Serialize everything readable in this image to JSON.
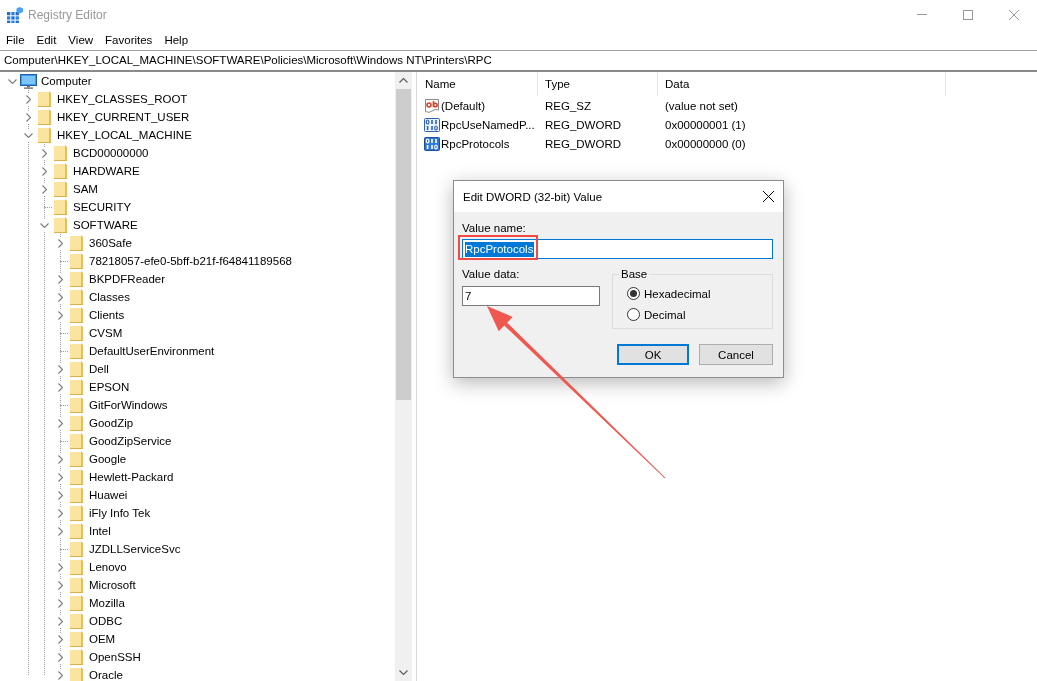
{
  "window": {
    "title": "Registry Editor",
    "active": false
  },
  "menu": [
    "File",
    "Edit",
    "View",
    "Favorites",
    "Help"
  ],
  "address": "Computer\\HKEY_LOCAL_MACHINE\\SOFTWARE\\Policies\\Microsoft\\Windows NT\\Printers\\RPC",
  "tree": [
    {
      "label": "Computer",
      "kind": "computer",
      "has_subkeys": true,
      "expanded": true,
      "children": [
        {
          "label": "HKEY_CLASSES_ROOT",
          "kind": "folder",
          "has_subkeys": true,
          "expanded": false
        },
        {
          "label": "HKEY_CURRENT_USER",
          "kind": "folder",
          "has_subkeys": true,
          "expanded": false
        },
        {
          "label": "HKEY_LOCAL_MACHINE",
          "kind": "folder",
          "has_subkeys": true,
          "expanded": true,
          "children": [
            {
              "label": "BCD00000000",
              "kind": "folder",
              "has_subkeys": true,
              "expanded": false
            },
            {
              "label": "HARDWARE",
              "kind": "folder",
              "has_subkeys": true,
              "expanded": false
            },
            {
              "label": "SAM",
              "kind": "folder",
              "has_subkeys": true,
              "expanded": false
            },
            {
              "label": "SECURITY",
              "kind": "folder",
              "has_subkeys": false,
              "expanded": false
            },
            {
              "label": "SOFTWARE",
              "kind": "folder",
              "has_subkeys": true,
              "expanded": true,
              "children": [
                {
                  "label": "360Safe",
                  "kind": "folder",
                  "has_subkeys": true,
                  "expanded": false
                },
                {
                  "label": "78218057-efe0-5bff-b21f-f64841189568",
                  "kind": "folder",
                  "has_subkeys": false,
                  "expanded": false
                },
                {
                  "label": "BKPDFReader",
                  "kind": "folder",
                  "has_subkeys": true,
                  "expanded": false
                },
                {
                  "label": "Classes",
                  "kind": "folder",
                  "has_subkeys": true,
                  "expanded": false
                },
                {
                  "label": "Clients",
                  "kind": "folder",
                  "has_subkeys": true,
                  "expanded": false
                },
                {
                  "label": "CVSM",
                  "kind": "folder",
                  "has_subkeys": false,
                  "expanded": false
                },
                {
                  "label": "DefaultUserEnvironment",
                  "kind": "folder",
                  "has_subkeys": false,
                  "expanded": false
                },
                {
                  "label": "Dell",
                  "kind": "folder",
                  "has_subkeys": true,
                  "expanded": false
                },
                {
                  "label": "EPSON",
                  "kind": "folder",
                  "has_subkeys": true,
                  "expanded": false
                },
                {
                  "label": "GitForWindows",
                  "kind": "folder",
                  "has_subkeys": false,
                  "expanded": false
                },
                {
                  "label": "GoodZip",
                  "kind": "folder",
                  "has_subkeys": true,
                  "expanded": false
                },
                {
                  "label": "GoodZipService",
                  "kind": "folder",
                  "has_subkeys": false,
                  "expanded": false
                },
                {
                  "label": "Google",
                  "kind": "folder",
                  "has_subkeys": true,
                  "expanded": false
                },
                {
                  "label": "Hewlett-Packard",
                  "kind": "folder",
                  "has_subkeys": true,
                  "expanded": false
                },
                {
                  "label": "Huawei",
                  "kind": "folder",
                  "has_subkeys": true,
                  "expanded": false
                },
                {
                  "label": "iFly Info Tek",
                  "kind": "folder",
                  "has_subkeys": true,
                  "expanded": false
                },
                {
                  "label": "Intel",
                  "kind": "folder",
                  "has_subkeys": true,
                  "expanded": false
                },
                {
                  "label": "JZDLLServiceSvc",
                  "kind": "folder",
                  "has_subkeys": false,
                  "expanded": false
                },
                {
                  "label": "Lenovo",
                  "kind": "folder",
                  "has_subkeys": true,
                  "expanded": false
                },
                {
                  "label": "Microsoft",
                  "kind": "folder",
                  "has_subkeys": true,
                  "expanded": false
                },
                {
                  "label": "Mozilla",
                  "kind": "folder",
                  "has_subkeys": true,
                  "expanded": false
                },
                {
                  "label": "ODBC",
                  "kind": "folder",
                  "has_subkeys": true,
                  "expanded": false
                },
                {
                  "label": "OEM",
                  "kind": "folder",
                  "has_subkeys": true,
                  "expanded": false
                },
                {
                  "label": "OpenSSH",
                  "kind": "folder",
                  "has_subkeys": true,
                  "expanded": false
                },
                {
                  "label": "Oracle",
                  "kind": "folder",
                  "has_subkeys": true,
                  "expanded": false
                }
              ]
            }
          ]
        }
      ]
    }
  ],
  "values": {
    "columns": [
      "Name",
      "Type",
      "Data"
    ],
    "rows": [
      {
        "kind": "string",
        "name": "(Default)",
        "type": "REG_SZ",
        "data": "(value not set)",
        "selected": false
      },
      {
        "kind": "dword",
        "name": "RpcUseNamedP...",
        "type": "REG_DWORD",
        "data": "0x00000001 (1)",
        "selected": false
      },
      {
        "kind": "dword",
        "name": "RpcProtocols",
        "type": "REG_DWORD",
        "data": "0x00000000 (0)",
        "selected": true
      }
    ]
  },
  "dialog": {
    "title": "Edit DWORD (32-bit) Value",
    "value_name": {
      "label": "Value name:",
      "value": "RpcProtocols",
      "focused": true,
      "highlighted": true
    },
    "value_data": {
      "label": "Value data:",
      "value": "7",
      "pointed_at": true
    },
    "base": {
      "label": "Base",
      "options": [
        {
          "label": "Hexadecimal",
          "selected": true
        },
        {
          "label": "Decimal",
          "selected": false
        }
      ]
    },
    "buttons": [
      {
        "label": "OK",
        "default": true
      },
      {
        "label": "Cancel",
        "default": false
      }
    ]
  }
}
